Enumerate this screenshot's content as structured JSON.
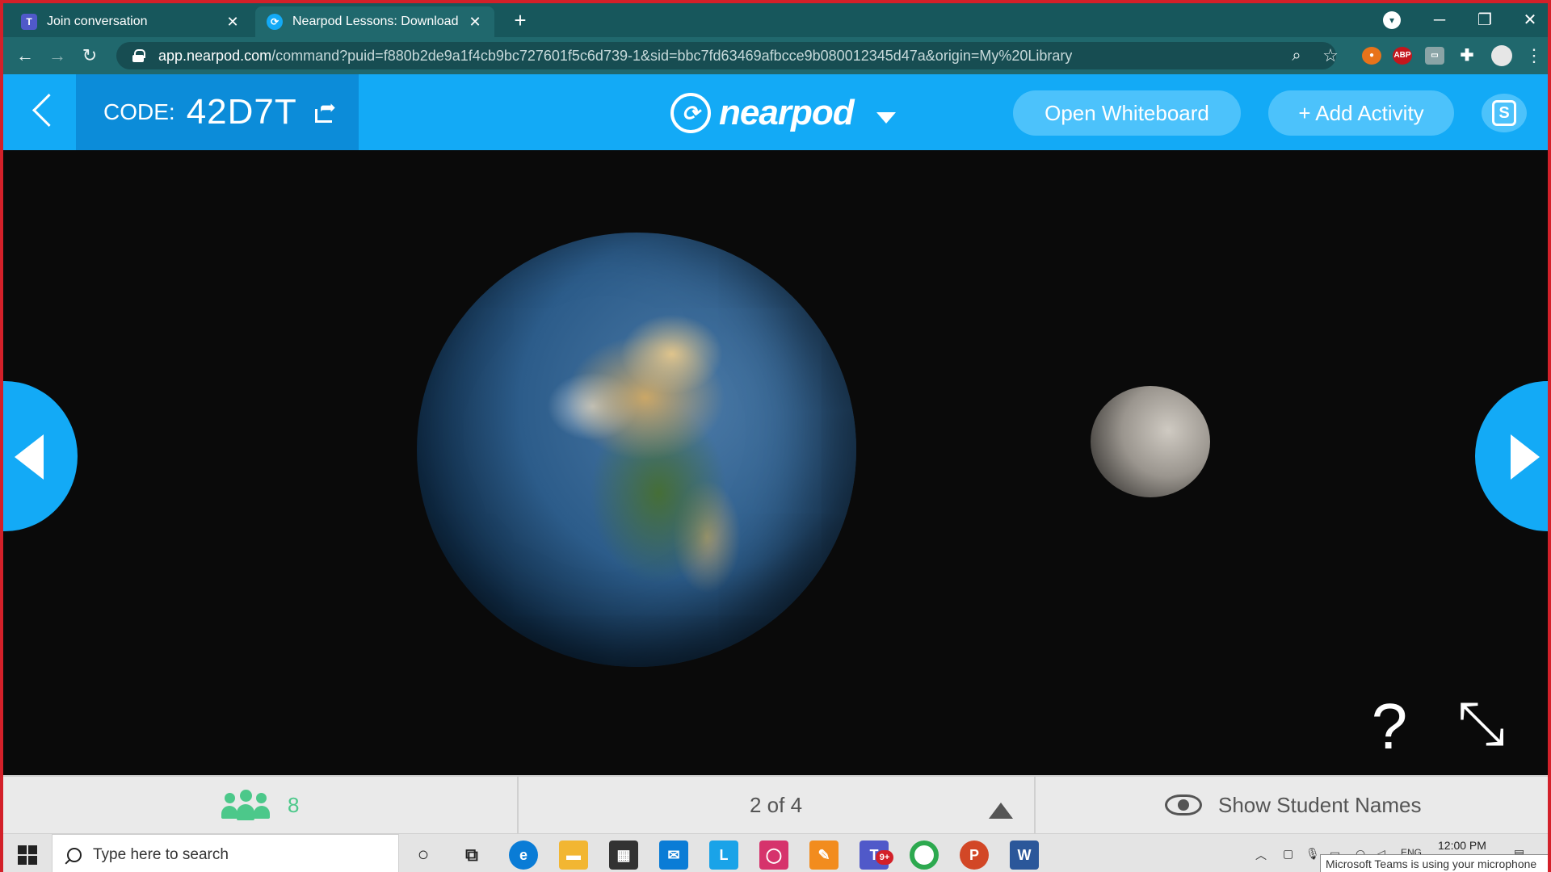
{
  "browser": {
    "tabs": [
      {
        "title": "Join conversation",
        "icon": "teams-icon",
        "active": false
      },
      {
        "title": "Nearpod Lessons: Download rea",
        "icon": "nearpod-icon",
        "active": true
      }
    ],
    "url_host": "app.nearpod.com",
    "url_path": "/command?puid=f880b2de9a1f4cb9bc727601f5c6d739-1&sid=bbc7fd63469afbcce9b080012345d47a&origin=My%20Library",
    "extensions": [
      "ABP"
    ]
  },
  "nearpod": {
    "code_label": "CODE:",
    "code_value": "42D7T",
    "logo_text": "nearpod",
    "open_whiteboard": "Open Whiteboard",
    "add_activity": "+ Add Activity",
    "student_view_letter": "S"
  },
  "stage": {
    "help": "?"
  },
  "bottom": {
    "student_count": "8",
    "pager": "2 of 4",
    "show_names": "Show Student Names"
  },
  "taskbar": {
    "search_placeholder": "Type here to search",
    "badge_count": "9+",
    "tray_lang": "ENG",
    "clock_time": "12:00 PM",
    "toast": "Microsoft Teams is using your microphone"
  },
  "colors": {
    "nearpod_blue": "#13aaf6",
    "nearpod_dark_blue": "#0c8cd9",
    "student_green": "#4cc88a",
    "chrome_frame": "#17575c",
    "border_red": "#d32029"
  }
}
